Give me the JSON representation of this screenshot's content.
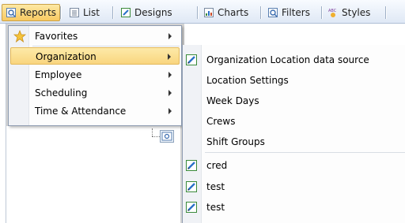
{
  "toolbar": {
    "items": [
      {
        "label": "Reports",
        "icon": "reports-icon"
      },
      {
        "label": "List",
        "icon": "list-icon"
      },
      {
        "label": "Designs",
        "icon": "designs-icon"
      },
      {
        "label": "Charts",
        "icon": "charts-icon"
      },
      {
        "label": "Filters",
        "icon": "filters-icon"
      },
      {
        "label": "Styles",
        "icon": "styles-icon"
      }
    ]
  },
  "menu": {
    "items": [
      {
        "label": "Favorites",
        "icon": "star-icon"
      },
      {
        "label": "Organization"
      },
      {
        "label": "Employee"
      },
      {
        "label": "Scheduling"
      },
      {
        "label": "Time & Attendance"
      }
    ]
  },
  "submenu": {
    "items": [
      {
        "label": "Organization Location data source",
        "icon": "edit-icon"
      },
      {
        "label": "Location Settings"
      },
      {
        "label": "Week Days"
      },
      {
        "label": "Crews"
      },
      {
        "label": "Shift Groups"
      },
      {
        "label": "cred",
        "icon": "edit-icon"
      },
      {
        "label": "test",
        "icon": "edit-icon"
      },
      {
        "label": "test",
        "icon": "edit-icon"
      }
    ]
  },
  "colors": {
    "accent_highlight": "#f9d57f",
    "toolbar_bg": "#dfe8f5",
    "menu_border": "#8d9bb0"
  }
}
